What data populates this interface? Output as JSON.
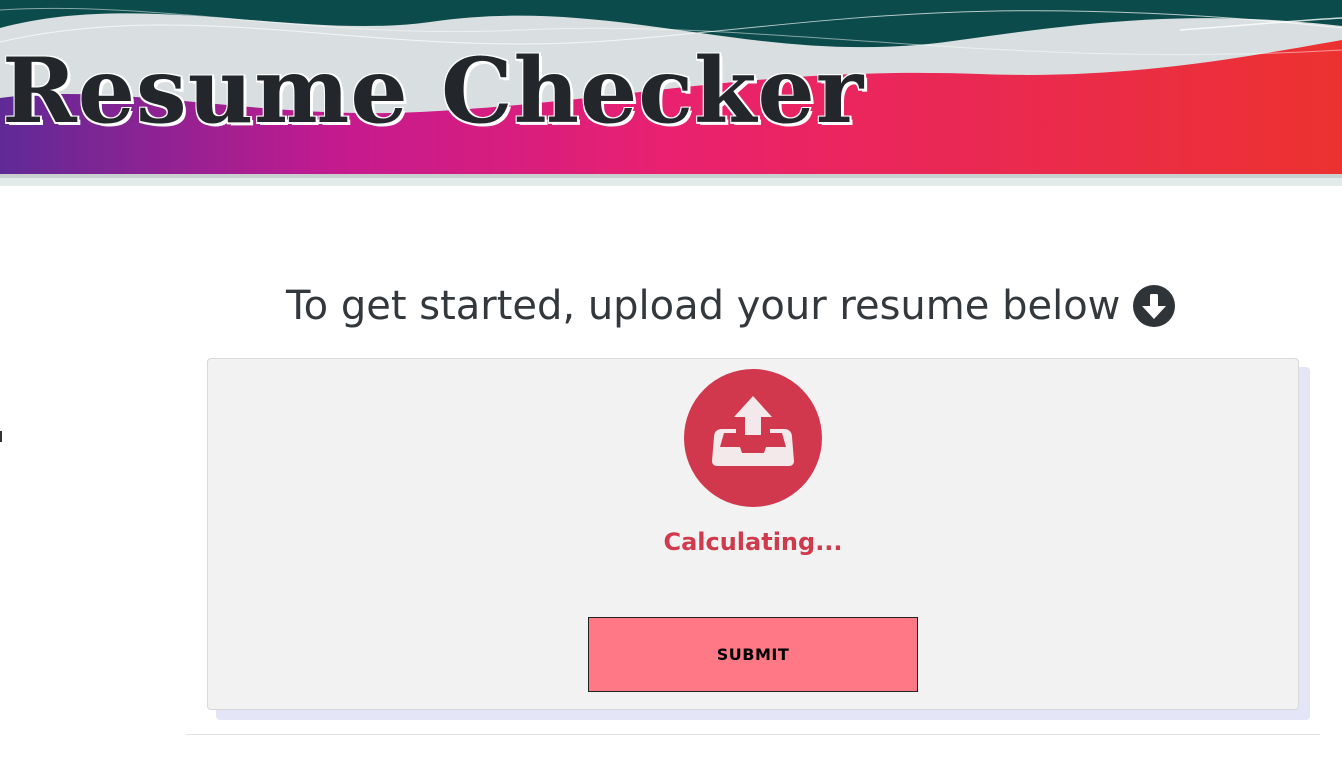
{
  "header": {
    "title": "Resume Checker"
  },
  "main": {
    "prompt": "To get started, upload your resume below",
    "prompt_icon": "arrow-circle-down-icon",
    "upload": {
      "icon": "upload-tray-icon",
      "status": "Calculating..."
    },
    "submit_label": "SUBMIT"
  },
  "colors": {
    "accent": "#d1384d",
    "submit_bg": "#ff7885",
    "card_bg": "#f2f2f2",
    "header_dark": "#0b4b4b",
    "title_text": "#23272b"
  }
}
